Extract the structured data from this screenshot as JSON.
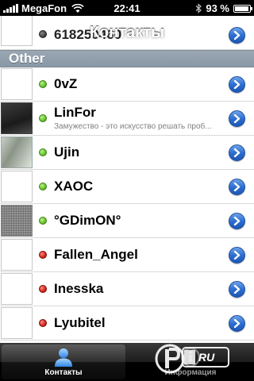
{
  "status_bar": {
    "carrier": "MegaFon",
    "time": "22:41",
    "battery": "93 %",
    "battery_level": 0.93
  },
  "navigation": {
    "title": "Контакты"
  },
  "contacts": {
    "partial_top": {
      "name": "618250460",
      "status": "offline"
    },
    "section_title": "Other",
    "items": [
      {
        "name": "0vZ",
        "subtitle": "",
        "status": "online",
        "avatar": "blank"
      },
      {
        "name": "LinFor",
        "subtitle": "Замужество - это искусство решать проб...",
        "status": "online",
        "avatar": "photo-dark"
      },
      {
        "name": "Ujin",
        "subtitle": "",
        "status": "online",
        "avatar": "photo"
      },
      {
        "name": "XAOC",
        "subtitle": "",
        "status": "online",
        "avatar": "blank"
      },
      {
        "name": "°GDimON°",
        "subtitle": "",
        "status": "online",
        "avatar": "noise"
      },
      {
        "name": "Fallen_Angel",
        "subtitle": "",
        "status": "offline",
        "avatar": "blank"
      },
      {
        "name": "Inesska",
        "subtitle": "",
        "status": "offline",
        "avatar": "blank"
      },
      {
        "name": "Lyubitel",
        "subtitle": "",
        "status": "offline",
        "avatar": "blank"
      }
    ]
  },
  "tab_bar": {
    "tabs": [
      {
        "label": "Контакты",
        "icon": "contacts-icon",
        "selected": true
      },
      {
        "label": "Информация",
        "icon": "info-icon",
        "selected": false
      }
    ]
  },
  "watermark": {
    "text": "RU"
  },
  "colors": {
    "accent_blue": "#2d6fd1",
    "online_green": "#6cc531",
    "offline_red": "#d62b20",
    "section_header": "#8f9daa"
  }
}
